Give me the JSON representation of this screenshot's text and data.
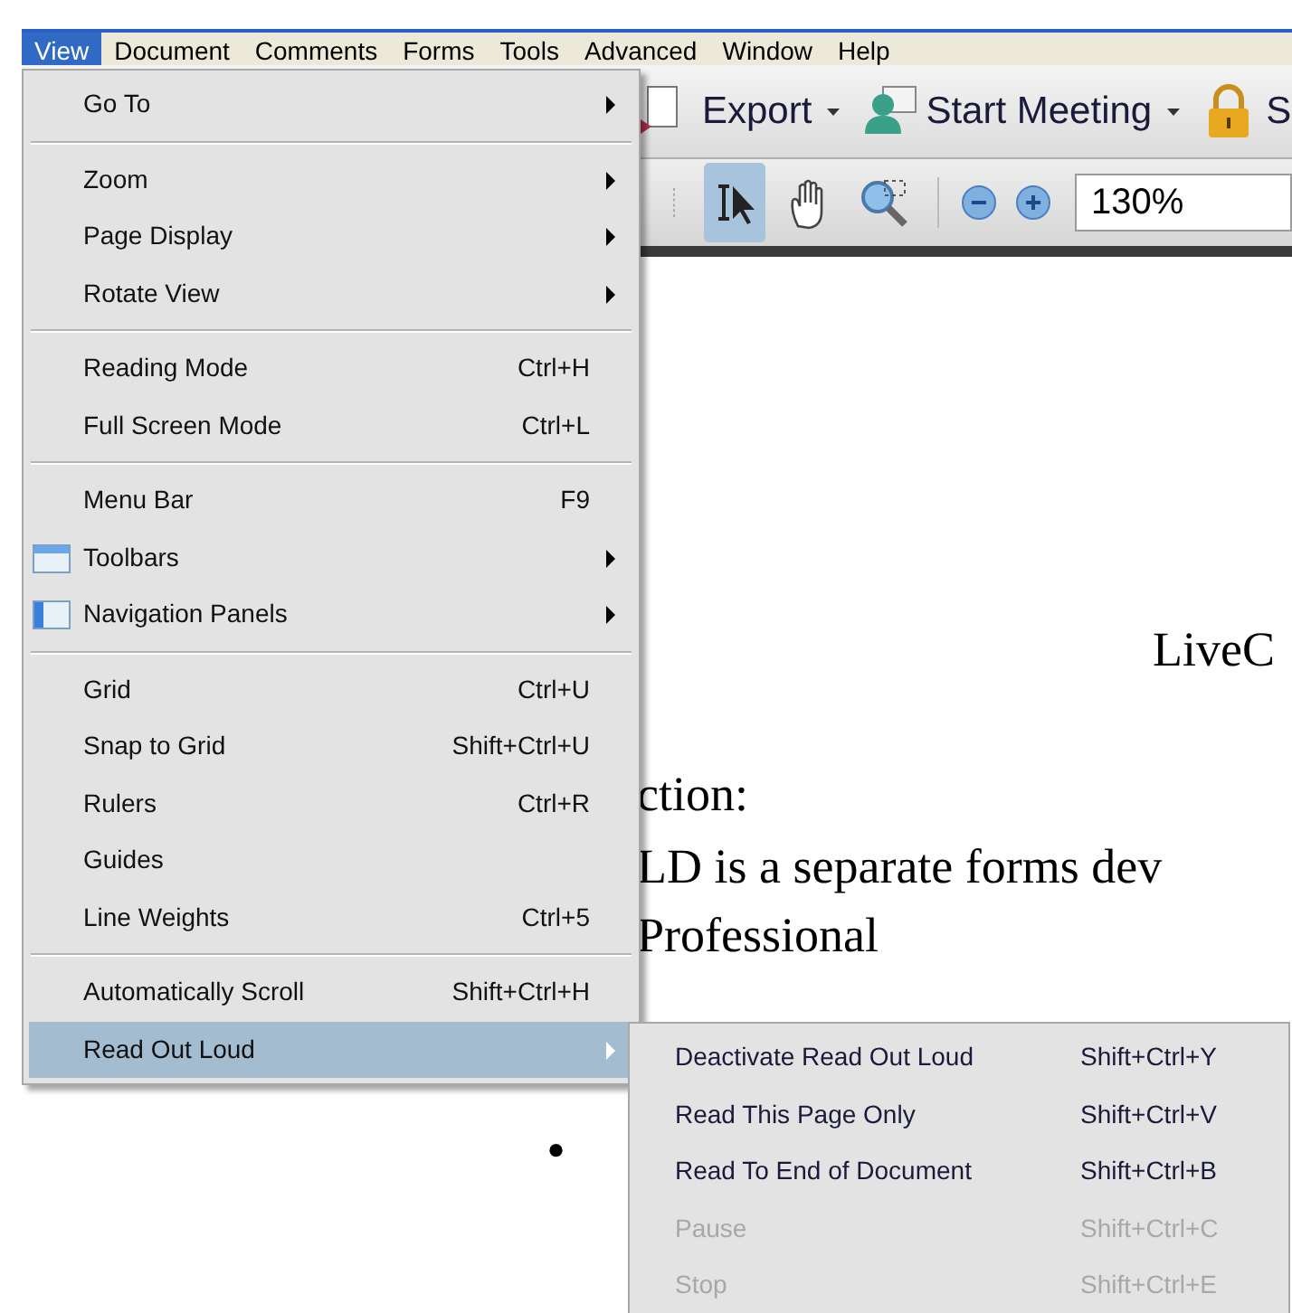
{
  "menu_bar": [
    {
      "label": "View",
      "selected": true
    },
    {
      "label": "Document",
      "selected": false
    },
    {
      "label": "Comments",
      "selected": false
    },
    {
      "label": "Forms",
      "selected": false
    },
    {
      "label": "Tools",
      "selected": false
    },
    {
      "label": "Advanced",
      "selected": false
    },
    {
      "label": "Window",
      "selected": false
    },
    {
      "label": "Help",
      "selected": false
    }
  ],
  "toolbar": {
    "buttons": [
      {
        "kind": "export",
        "label": "Export",
        "dropdown": true
      },
      {
        "kind": "meeting",
        "label": "Start Meeting",
        "dropdown": true
      },
      {
        "kind": "secure",
        "label": "S",
        "dropdown": false
      }
    ],
    "tools": [
      {
        "kind": "select",
        "selected": true
      },
      {
        "kind": "hand",
        "selected": false
      },
      {
        "kind": "marquee_zoom",
        "selected": false
      },
      {
        "kind": "separator"
      },
      {
        "kind": "zoom_out",
        "selected": false
      },
      {
        "kind": "zoom_in",
        "selected": false
      }
    ],
    "zoom_field": {
      "value": "130%"
    }
  },
  "document": {
    "lines": [
      {
        "kind": "title",
        "text": "LiveC"
      },
      {
        "kind": "body",
        "text": "ction:"
      },
      {
        "kind": "body",
        "text": "LD is a separate forms dev"
      },
      {
        "kind": "body",
        "text": "Professional"
      },
      {
        "kind": "bullet",
        "text": "•"
      }
    ]
  },
  "view_menu": {
    "items": [
      {
        "kind": "item",
        "label": "Go To",
        "submenu": true,
        "selected": false
      },
      {
        "kind": "separator"
      },
      {
        "kind": "item",
        "label": "Zoom",
        "submenu": true,
        "selected": false
      },
      {
        "kind": "item",
        "label": "Page Display",
        "submenu": true,
        "selected": false
      },
      {
        "kind": "item",
        "label": "Rotate View",
        "submenu": true,
        "selected": false
      },
      {
        "kind": "separator"
      },
      {
        "kind": "item",
        "label": "Reading Mode",
        "shortcut": "Ctrl+H",
        "submenu": false,
        "selected": false
      },
      {
        "kind": "item",
        "label": "Full Screen Mode",
        "shortcut": "Ctrl+L",
        "submenu": false,
        "selected": false
      },
      {
        "kind": "separator"
      },
      {
        "kind": "item",
        "label": "Menu Bar",
        "shortcut": "F9",
        "submenu": false,
        "selected": false
      },
      {
        "kind": "window_icon_item",
        "label": "Toolbars",
        "submenu": true,
        "selected": false
      },
      {
        "kind": "panel_icon_item",
        "label": "Navigation Panels",
        "submenu": true,
        "selected": false
      },
      {
        "kind": "separator"
      },
      {
        "kind": "item",
        "label": "Grid",
        "shortcut": "Ctrl+U",
        "submenu": false,
        "selected": false
      },
      {
        "kind": "item",
        "label": "Snap to Grid",
        "shortcut": "Shift+Ctrl+U",
        "submenu": false,
        "selected": false
      },
      {
        "kind": "item",
        "label": "Rulers",
        "shortcut": "Ctrl+R",
        "submenu": false,
        "selected": false
      },
      {
        "kind": "item",
        "label": "Guides",
        "submenu": false,
        "selected": false
      },
      {
        "kind": "item",
        "label": "Line Weights",
        "shortcut": "Ctrl+5",
        "submenu": false,
        "selected": false
      },
      {
        "kind": "separator"
      },
      {
        "kind": "item",
        "label": "Automatically Scroll",
        "shortcut": "Shift+Ctrl+H",
        "submenu": false,
        "selected": false
      },
      {
        "kind": "item",
        "label": "Read Out Loud",
        "submenu": true,
        "selected": true
      }
    ]
  },
  "read_out_loud_menu": {
    "items": [
      {
        "label": "Deactivate Read Out Loud",
        "shortcut": "Shift+Ctrl+Y",
        "disabled": false
      },
      {
        "label": "Read This Page Only",
        "shortcut": "Shift+Ctrl+V",
        "disabled": false
      },
      {
        "label": "Read To End of Document",
        "shortcut": "Shift+Ctrl+B",
        "disabled": false
      },
      {
        "label": "Pause",
        "shortcut": "Shift+Ctrl+C",
        "disabled": true
      },
      {
        "label": "Stop",
        "shortcut": "Shift+Ctrl+E",
        "disabled": true
      }
    ]
  }
}
